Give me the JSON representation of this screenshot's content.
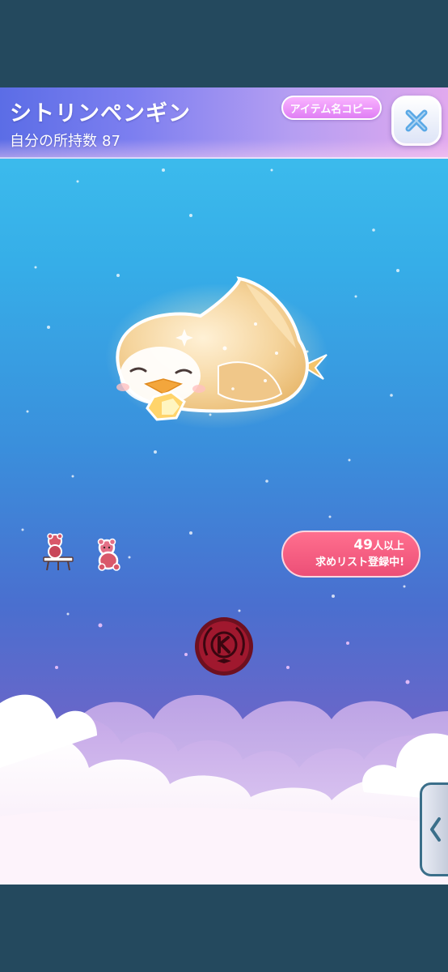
{
  "item": {
    "name": "シトリンペンギン",
    "owned_label": "自分の所持数",
    "owned_count": "87"
  },
  "header": {
    "copy_button_label": "アイテム名コピー",
    "close_icon": "close-x-icon"
  },
  "wishlist_badge": {
    "count": "49",
    "unit": "人以上",
    "status": "求めリスト登録中!"
  },
  "side_tab": {
    "icon": "chevron-left-icon"
  },
  "colors": {
    "header_gradient_start": "#5b6de6",
    "header_gradient_end": "#e1a9ee",
    "badge_pink": "#ec4f77",
    "copy_button_pink": "#e07ff4",
    "page_background": "#24495e",
    "sky_top": "#3fc3ef",
    "sky_bottom": "#8b7fd0"
  }
}
